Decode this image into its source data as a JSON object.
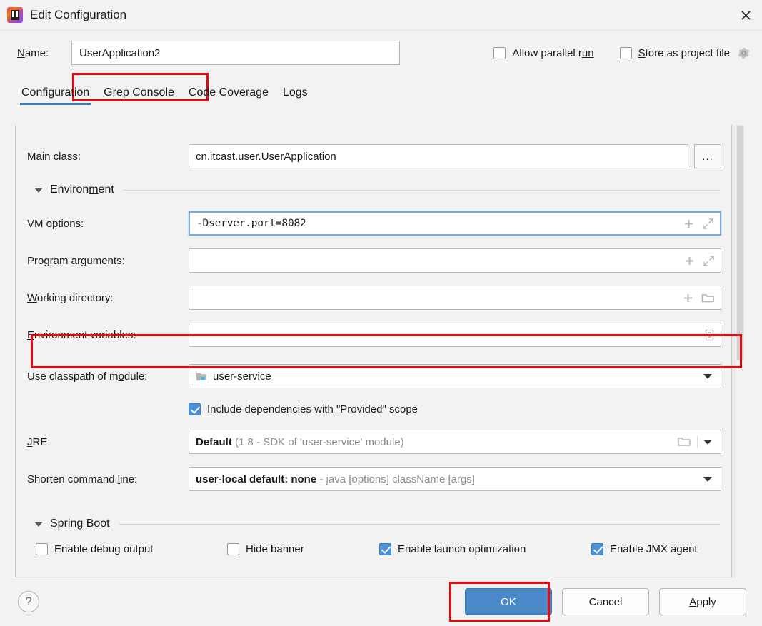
{
  "window": {
    "title": "Edit Configuration",
    "app_icon": "intellij-idea-icon",
    "close_icon": "close-icon"
  },
  "name_row": {
    "label": "Name:",
    "value": "UserApplication2",
    "highlighted": true,
    "checkboxes": [
      {
        "label": "Allow parallel run",
        "checked": false
      },
      {
        "label": "Store as project file",
        "checked": false
      }
    ],
    "gear_icon": "gear-icon"
  },
  "tabs": [
    {
      "label": "Configuration",
      "active": true
    },
    {
      "label": "Grep Console",
      "active": false
    },
    {
      "label": "Code Coverage",
      "active": false
    },
    {
      "label": "Logs",
      "active": false
    }
  ],
  "form": {
    "main_class": {
      "label": "Main class:",
      "value": "cn.itcast.user.UserApplication",
      "browse_label": "..."
    },
    "environment_section": {
      "title": "Environment",
      "expanded": true
    },
    "vm_options": {
      "label": "VM options:",
      "value": "-Dserver.port=8082",
      "focused": true,
      "highlighted": true,
      "icons": [
        "plus-icon",
        "expand-icon"
      ]
    },
    "program_arguments": {
      "label": "Program arguments:",
      "value": "",
      "icons": [
        "plus-icon",
        "expand-icon"
      ]
    },
    "working_directory": {
      "label": "Working directory:",
      "value": "",
      "icons": [
        "plus-icon",
        "folder-icon"
      ]
    },
    "environment_variables": {
      "label": "Environment variables:",
      "value": "",
      "icons": [
        "browse-list-icon"
      ]
    },
    "classpath_module": {
      "label": "Use classpath of module:",
      "value": "user-service",
      "module_icon": "module-folder-icon"
    },
    "include_dependencies": {
      "label": "Include dependencies with \"Provided\" scope",
      "checked": true
    },
    "jre": {
      "label": "JRE:",
      "value_bold": "Default",
      "value_gray": "(1.8 - SDK of 'user-service' module)",
      "folder_icon": "folder-icon"
    },
    "shorten_command_line": {
      "label": "Shorten command line:",
      "value_bold": "user-local default: none",
      "value_gray": "- java [options] className [args]"
    },
    "spring_boot_section": {
      "title": "Spring Boot",
      "expanded": true,
      "checkboxes": [
        {
          "label": "Enable debug output",
          "checked": false
        },
        {
          "label": "Hide banner",
          "checked": false
        },
        {
          "label": "Enable launch optimization",
          "checked": true
        },
        {
          "label": "Enable JMX agent",
          "checked": true
        }
      ]
    }
  },
  "footer": {
    "help_label": "?",
    "ok_label": "OK",
    "ok_highlighted": true,
    "cancel_label": "Cancel",
    "apply_label": "Apply"
  },
  "colors": {
    "accent_blue": "#4a88c7",
    "tab_underline": "#3d7ab5",
    "highlight_red": "#e50914",
    "checkbox_checked": "#4a90d9",
    "window_bg": "#f2f2f2"
  }
}
